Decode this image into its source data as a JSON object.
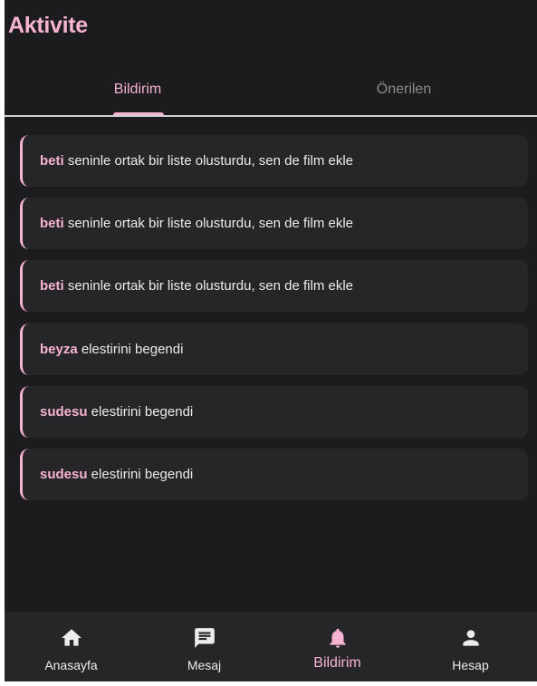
{
  "header": {
    "title": "Aktivite"
  },
  "tabs": [
    {
      "label": "Bildirim",
      "active": true
    },
    {
      "label": "Önerilen",
      "active": false
    }
  ],
  "notifications": [
    {
      "user": "beti",
      "text": " seninle ortak bir liste olusturdu, sen de film ekle"
    },
    {
      "user": "beti",
      "text": " seninle ortak bir liste olusturdu, sen de film ekle"
    },
    {
      "user": "beti",
      "text": " seninle ortak bir liste olusturdu, sen de film ekle"
    },
    {
      "user": "beyza",
      "text": " elestirini begendi"
    },
    {
      "user": "sudesu",
      "text": " elestirini begendi"
    },
    {
      "user": "sudesu",
      "text": " elestirini begendi"
    }
  ],
  "bottom_nav": [
    {
      "label": "Anasayfa",
      "icon": "home-icon",
      "active": false
    },
    {
      "label": "Mesaj",
      "icon": "message-icon",
      "active": false
    },
    {
      "label": "Bildirim",
      "icon": "bell-icon",
      "active": true
    },
    {
      "label": "Hesap",
      "icon": "person-icon",
      "active": false
    }
  ],
  "colors": {
    "accent": "#f7b3d2",
    "background": "#1c1b1d",
    "card": "#262528",
    "text": "#ecebed",
    "muted": "#8e8a8f"
  }
}
